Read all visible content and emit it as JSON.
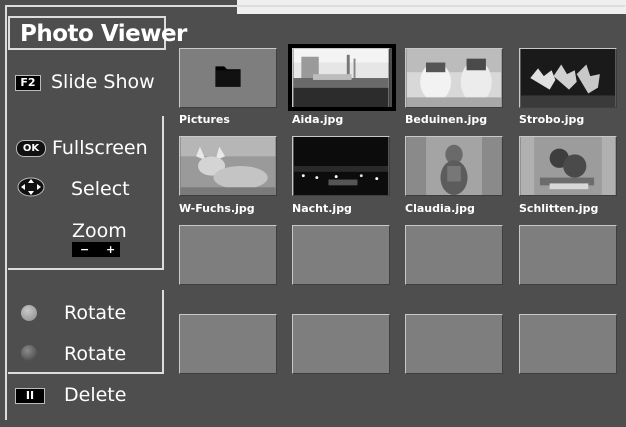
{
  "app": {
    "title": "Photo Viewer"
  },
  "sidebar": {
    "slideshow": {
      "key": "F2",
      "label": "Slide Show"
    },
    "fullscreen": {
      "key": "OK",
      "label": "Fullscreen"
    },
    "select": {
      "label": "Select"
    },
    "zoom": {
      "label": "Zoom",
      "minus": "−",
      "plus": "+"
    },
    "rotate_left": {
      "label": "Rotate",
      "color": "#9a9a9a"
    },
    "rotate_right": {
      "label": "Rotate",
      "color": "#5a5a5a"
    },
    "delete": {
      "key": "II",
      "label": "Delete"
    }
  },
  "grid": {
    "selected_index": 1,
    "items": [
      {
        "name": "Pictures",
        "type": "folder",
        "icon": "folder-icon"
      },
      {
        "name": "Aida.jpg",
        "type": "image"
      },
      {
        "name": "Beduinen.jpg",
        "type": "image"
      },
      {
        "name": "Strobo.jpg",
        "type": "image"
      },
      {
        "name": "W-Fuchs.jpg",
        "type": "image"
      },
      {
        "name": "Nacht.jpg",
        "type": "image"
      },
      {
        "name": "Claudia.jpg",
        "type": "image"
      },
      {
        "name": "Schlitten.jpg",
        "type": "image"
      },
      {
        "name": "",
        "type": "empty"
      },
      {
        "name": "",
        "type": "empty"
      },
      {
        "name": "",
        "type": "empty"
      },
      {
        "name": "",
        "type": "empty"
      },
      {
        "name": "",
        "type": "empty"
      },
      {
        "name": "",
        "type": "empty"
      },
      {
        "name": "",
        "type": "empty"
      },
      {
        "name": "",
        "type": "empty"
      }
    ]
  },
  "colors": {
    "background": "#4e4e4e",
    "cell": "#7e7e7e",
    "text": "#ffffff",
    "selection": "#000000"
  }
}
